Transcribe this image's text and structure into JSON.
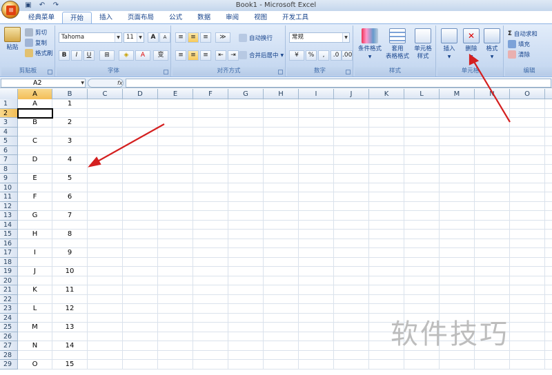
{
  "window": {
    "title": "Book1 - Microsoft Excel"
  },
  "qat": {
    "icons": [
      "save-icon",
      "undo-icon",
      "redo-icon"
    ]
  },
  "tabs": [
    {
      "label": "经典菜单"
    },
    {
      "label": "开始",
      "active": true
    },
    {
      "label": "插入"
    },
    {
      "label": "页面布局"
    },
    {
      "label": "公式"
    },
    {
      "label": "数据"
    },
    {
      "label": "审阅"
    },
    {
      "label": "视图"
    },
    {
      "label": "开发工具"
    }
  ],
  "ribbon": {
    "clipboard": {
      "group": "剪贴板",
      "paste": "粘贴",
      "cut": "剪切",
      "copy": "复制",
      "format_painter": "格式刷"
    },
    "font": {
      "group": "字体",
      "font_name": "Tahoma",
      "font_size": "11",
      "bold": "B",
      "italic": "I",
      "underline": "U",
      "grow": "A",
      "shrink": "A"
    },
    "alignment": {
      "group": "对齐方式",
      "wrap_text": "自动换行",
      "merge_center": "合并后居中"
    },
    "number": {
      "group": "数字",
      "format": "常规",
      "percent": "%",
      "comma": ","
    },
    "styles": {
      "group": "样式",
      "conditional": "条件格式",
      "table_format_1": "套用",
      "table_format_2": "表格格式",
      "cell_style_1": "单元格",
      "cell_style_2": "样式"
    },
    "cells": {
      "group": "单元格",
      "insert": "插入",
      "delete": "删除",
      "format": "格式"
    },
    "editing": {
      "group": "编辑",
      "autosum": "自动求和",
      "fill": "填充",
      "clear": "清除"
    }
  },
  "formula_bar": {
    "name_box": "A2",
    "fx": "fx",
    "content": ""
  },
  "columns": [
    "A",
    "B",
    "C",
    "D",
    "E",
    "F",
    "G",
    "H",
    "I",
    "J",
    "K",
    "L",
    "M",
    "N",
    "O"
  ],
  "selected_column": "A",
  "selected_row": "2",
  "row_labels": [
    "1",
    "2",
    "3",
    "4",
    "5",
    "6",
    "7",
    "8",
    "9",
    "10",
    "11",
    "12",
    "13",
    "14",
    "15",
    "16",
    "17",
    "18",
    "19",
    "20",
    "21",
    "22",
    "23",
    "24",
    "25",
    "26",
    "27",
    "28",
    "29"
  ],
  "cells": {
    "A": [
      "A",
      "",
      "B",
      "",
      "C",
      "",
      "D",
      "",
      "E",
      "",
      "F",
      "",
      "G",
      "",
      "H",
      "",
      "I",
      "",
      "J",
      "",
      "K",
      "",
      "L",
      "",
      "M",
      "",
      "N",
      "",
      "O"
    ],
    "B": [
      "1",
      "",
      "2",
      "",
      "3",
      "",
      "4",
      "",
      "5",
      "",
      "6",
      "",
      "7",
      "",
      "8",
      "",
      "9",
      "",
      "10",
      "",
      "11",
      "",
      "12",
      "",
      "13",
      "",
      "14",
      "",
      "15"
    ]
  },
  "watermark": "软件技巧",
  "colors": {
    "arrow": "#d42020",
    "selected_header": "#f3be57"
  }
}
